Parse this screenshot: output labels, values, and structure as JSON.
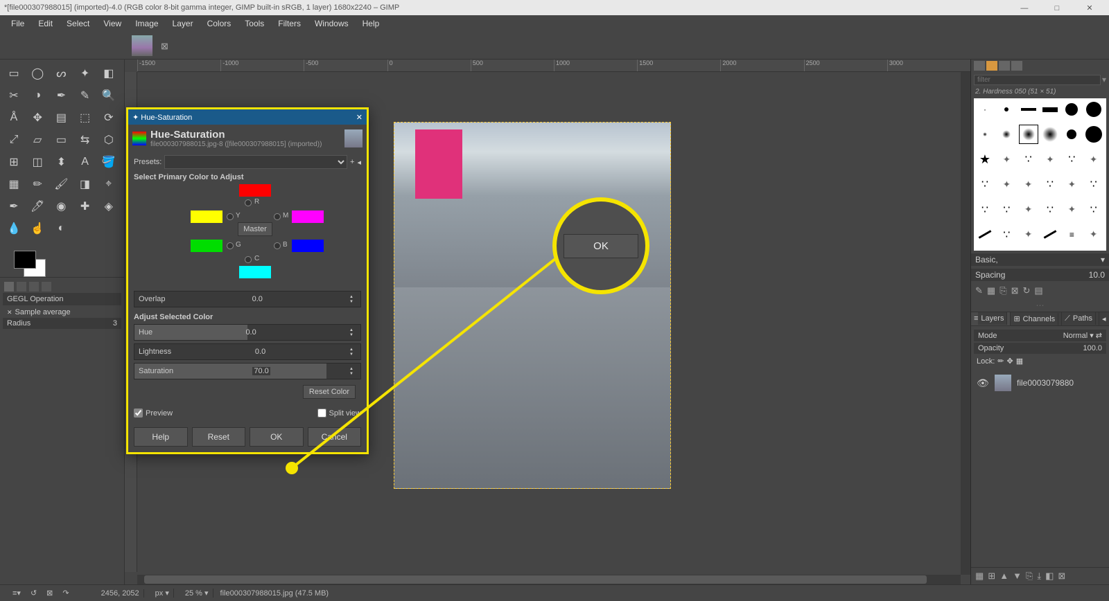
{
  "window": {
    "title": "*[file000307988015] (imported)-4.0 (RGB color 8-bit gamma integer, GIMP built-in sRGB, 1 layer) 1680x2240 – GIMP",
    "min": "—",
    "max": "□",
    "close": "✕"
  },
  "menu": [
    "File",
    "Edit",
    "Select",
    "View",
    "Image",
    "Layer",
    "Colors",
    "Tools",
    "Filters",
    "Windows",
    "Help"
  ],
  "ruler_marks": [
    "-1500",
    "-1000",
    "-500",
    "0",
    "500",
    "1000",
    "1500",
    "2000",
    "2500",
    "3000"
  ],
  "tooloptions": {
    "header": "GEGL Operation",
    "sample": "Sample average",
    "radius_label": "Radius",
    "radius_val": "3"
  },
  "right": {
    "brushname": "2. Hardness 050 (51 × 51)",
    "filter_placeholder": "filter",
    "basic": "Basic,",
    "spacing_label": "Spacing",
    "spacing_val": "10.0",
    "tabs2": [
      "Layers",
      "Channels",
      "Paths"
    ],
    "mode_label": "Mode",
    "mode_val": "Normal",
    "opacity_label": "Opacity",
    "opacity_val": "100.0",
    "lock_label": "Lock:",
    "layer_name": "file0003079880"
  },
  "status": {
    "coords": "2456, 2052",
    "unit": "px",
    "zoom": "25 %",
    "file": "file000307988015.jpg (47.5 MB)"
  },
  "dialog": {
    "titlebar": "Hue-Saturation",
    "header": "Hue-Saturation",
    "sub": "file000307988015.jpg-8 ([file000307988015] (imported))",
    "presets_label": "Presets:",
    "select_primary": "Select Primary Color to Adjust",
    "labels": {
      "R": "R",
      "Y": "Y",
      "M": "M",
      "G": "G",
      "B": "B",
      "C": "C",
      "master": "Master"
    },
    "overlap_label": "Overlap",
    "overlap_val": "0.0",
    "adjust_header": "Adjust Selected Color",
    "hue_label": "Hue",
    "hue_val": "0.0",
    "light_label": "Lightness",
    "light_val": "0.0",
    "sat_label": "Saturation",
    "sat_val": "70.0",
    "reset_color": "Reset Color",
    "preview": "Preview",
    "split": "Split view",
    "buttons": {
      "help": "Help",
      "reset": "Reset",
      "ok": "OK",
      "cancel": "Cancel"
    }
  },
  "magnify": {
    "ok": "OK"
  }
}
